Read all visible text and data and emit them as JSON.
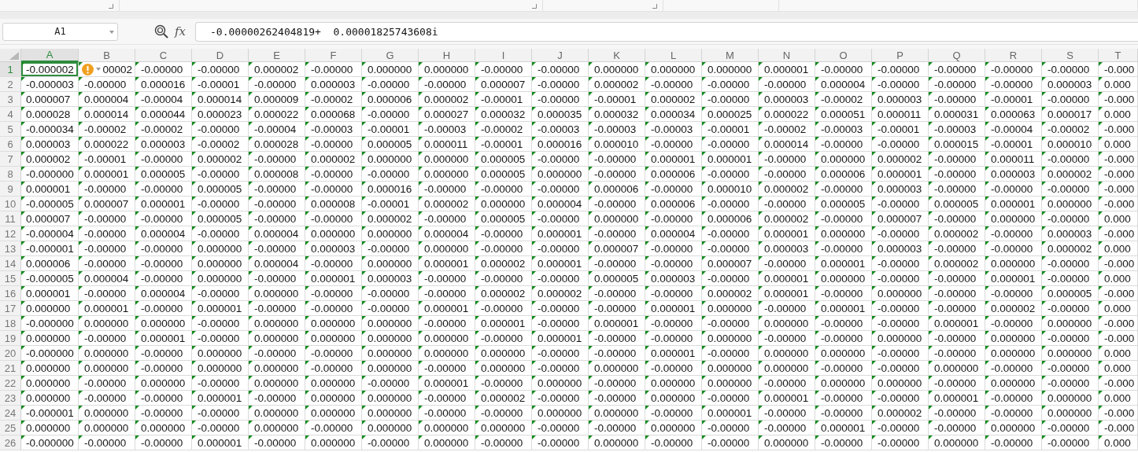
{
  "ribbon": {
    "groups": [
      {
        "launcher": true
      },
      {
        "launcher": true
      },
      {
        "launcher": true
      },
      {
        "launcher": false
      },
      {
        "launcher": false
      }
    ]
  },
  "formula_bar": {
    "name_box": "A1",
    "function_label": "fx",
    "formula": "-0.00000262404819+  0.00001825743608i"
  },
  "error_check": {
    "visible": true
  },
  "columns": [
    {
      "label": "A",
      "selected": true
    },
    {
      "label": "B",
      "selected": false
    },
    {
      "label": "C",
      "selected": false
    },
    {
      "label": "D",
      "selected": false
    },
    {
      "label": "E",
      "selected": false
    },
    {
      "label": "F",
      "selected": false
    },
    {
      "label": "G",
      "selected": false
    },
    {
      "label": "H",
      "selected": false
    },
    {
      "label": "I",
      "selected": false
    },
    {
      "label": "J",
      "selected": false
    },
    {
      "label": "K",
      "selected": false
    },
    {
      "label": "L",
      "selected": false
    },
    {
      "label": "M",
      "selected": false
    },
    {
      "label": "N",
      "selected": false
    },
    {
      "label": "O",
      "selected": false
    },
    {
      "label": "P",
      "selected": false
    },
    {
      "label": "Q",
      "selected": false
    },
    {
      "label": "R",
      "selected": false
    },
    {
      "label": "S",
      "selected": false
    },
    {
      "label": "T",
      "selected": false
    }
  ],
  "rows": [
    {
      "number": "1",
      "selected": true,
      "cells": [
        "-0.000002",
        "00002",
        "-0.00000",
        "-0.00000",
        "0.000002",
        "-0.00000",
        "0.000000",
        "0.000000",
        "-0.00000",
        "-0.00000",
        "0.000000",
        "0.000000",
        "0.000000",
        "0.000001",
        "-0.00000",
        "-0.00000",
        "-0.00000",
        "-0.00000",
        "-0.00000",
        "-0.000"
      ]
    },
    {
      "number": "2",
      "selected": false,
      "cells": [
        "-0.000003",
        "-0.00000",
        "0.000016",
        "-0.00001",
        "-0.00000",
        "0.000003",
        "-0.00000",
        "-0.00000",
        "0.000007",
        "-0.00000",
        "0.000002",
        "-0.00000",
        "-0.00000",
        "-0.00000",
        "0.000004",
        "-0.00000",
        "-0.00000",
        "-0.00000",
        "0.000003",
        "0.000"
      ]
    },
    {
      "number": "3",
      "selected": false,
      "cells": [
        "0.000007",
        "0.000004",
        "-0.00004",
        "0.000014",
        "0.000009",
        "-0.00002",
        "0.000006",
        "0.000002",
        "-0.00001",
        "-0.00000",
        "-0.00001",
        "0.000002",
        "-0.00000",
        "0.000003",
        "-0.00002",
        "0.000003",
        "-0.00000",
        "-0.00001",
        "-0.00000",
        "-0.000"
      ]
    },
    {
      "number": "4",
      "selected": false,
      "cells": [
        "0.000028",
        "0.000014",
        "0.000044",
        "0.000023",
        "0.000022",
        "0.000068",
        "-0.00000",
        "0.000027",
        "0.000032",
        "0.000035",
        "0.000032",
        "0.000034",
        "0.000025",
        "0.000022",
        "0.000051",
        "0.000011",
        "0.000031",
        "0.000063",
        "0.000017",
        "0.000"
      ]
    },
    {
      "number": "5",
      "selected": false,
      "cells": [
        "-0.000034",
        "-0.00002",
        "-0.00002",
        "-0.00000",
        "-0.00004",
        "-0.00003",
        "-0.00001",
        "-0.00003",
        "-0.00002",
        "-0.00003",
        "-0.00003",
        "-0.00003",
        "-0.00001",
        "-0.00002",
        "-0.00003",
        "-0.00001",
        "-0.00003",
        "-0.00004",
        "-0.00002",
        "-0.000"
      ]
    },
    {
      "number": "6",
      "selected": false,
      "cells": [
        "0.000003",
        "0.000022",
        "0.000003",
        "-0.00002",
        "0.000028",
        "-0.00000",
        "0.000005",
        "0.000011",
        "-0.00001",
        "0.000016",
        "0.000010",
        "-0.00000",
        "-0.00000",
        "0.000014",
        "-0.00000",
        "-0.00000",
        "0.000015",
        "-0.00001",
        "0.000010",
        "0.000"
      ]
    },
    {
      "number": "7",
      "selected": false,
      "cells": [
        "0.000002",
        "-0.00001",
        "-0.00000",
        "0.000002",
        "-0.00000",
        "0.000002",
        "0.000000",
        "0.000000",
        "0.000005",
        "-0.00000",
        "-0.00000",
        "0.000001",
        "0.000001",
        "-0.00000",
        "0.000000",
        "0.000002",
        "-0.00000",
        "0.000011",
        "-0.00000",
        "-0.000"
      ]
    },
    {
      "number": "8",
      "selected": false,
      "cells": [
        "-0.000000",
        "0.000001",
        "0.000005",
        "-0.00000",
        "0.000008",
        "-0.00000",
        "-0.00000",
        "0.000000",
        "0.000005",
        "0.000000",
        "-0.00000",
        "0.000006",
        "-0.00000",
        "-0.00000",
        "0.000006",
        "0.000001",
        "-0.00000",
        "0.000003",
        "0.000002",
        "-0.000"
      ]
    },
    {
      "number": "9",
      "selected": false,
      "cells": [
        "0.000001",
        "-0.00000",
        "-0.00000",
        "0.000005",
        "-0.00000",
        "-0.00000",
        "0.000016",
        "-0.00000",
        "-0.00000",
        "-0.00000",
        "0.000006",
        "-0.00000",
        "0.000010",
        "0.000002",
        "-0.00000",
        "0.000003",
        "-0.00000",
        "-0.00000",
        "-0.00000",
        "-0.000"
      ]
    },
    {
      "number": "10",
      "selected": false,
      "cells": [
        "-0.000005",
        "0.000007",
        "0.000001",
        "-0.00000",
        "-0.00000",
        "0.000008",
        "-0.00001",
        "0.000002",
        "0.000000",
        "0.000004",
        "-0.00000",
        "0.000006",
        "-0.00000",
        "-0.00000",
        "0.000005",
        "-0.00000",
        "0.000005",
        "0.000001",
        "0.000000",
        "-0.000"
      ]
    },
    {
      "number": "11",
      "selected": false,
      "cells": [
        "0.000007",
        "-0.00000",
        "-0.00000",
        "0.000005",
        "-0.00000",
        "-0.00000",
        "0.000002",
        "-0.00000",
        "0.000005",
        "-0.00000",
        "0.000000",
        "-0.00000",
        "0.000006",
        "0.000002",
        "-0.00000",
        "0.000007",
        "-0.00000",
        "0.000000",
        "-0.00000",
        "0.000"
      ]
    },
    {
      "number": "12",
      "selected": false,
      "cells": [
        "-0.000004",
        "-0.00000",
        "0.000004",
        "-0.00000",
        "0.000004",
        "0.000000",
        "0.000000",
        "0.000004",
        "-0.00000",
        "0.000001",
        "-0.00000",
        "0.000004",
        "-0.00000",
        "0.000001",
        "0.000000",
        "-0.00000",
        "0.000002",
        "-0.00000",
        "0.000003",
        "-0.000"
      ]
    },
    {
      "number": "13",
      "selected": false,
      "cells": [
        "-0.000001",
        "-0.00000",
        "-0.00000",
        "0.000000",
        "-0.00000",
        "0.000003",
        "-0.00000",
        "0.000000",
        "-0.00000",
        "-0.00000",
        "0.000007",
        "-0.00000",
        "-0.00000",
        "0.000003",
        "-0.00000",
        "0.000003",
        "-0.00000",
        "-0.00000",
        "0.000002",
        "0.000"
      ]
    },
    {
      "number": "14",
      "selected": false,
      "cells": [
        "0.000006",
        "-0.00000",
        "-0.00000",
        "0.000000",
        "0.000004",
        "-0.00000",
        "0.000000",
        "0.000001",
        "0.000002",
        "0.000001",
        "-0.00000",
        "-0.00000",
        "0.000007",
        "-0.00000",
        "0.000001",
        "-0.00000",
        "0.000002",
        "0.000000",
        "-0.00000",
        "-0.000"
      ]
    },
    {
      "number": "15",
      "selected": false,
      "cells": [
        "-0.000005",
        "0.000004",
        "-0.00000",
        "0.000000",
        "-0.00000",
        "0.000001",
        "0.000003",
        "-0.00000",
        "-0.00000",
        "-0.00000",
        "0.000005",
        "0.000003",
        "-0.00000",
        "0.000001",
        "0.000000",
        "-0.00000",
        "-0.00000",
        "0.000001",
        "-0.00000",
        "0.000"
      ]
    },
    {
      "number": "16",
      "selected": false,
      "cells": [
        "0.000001",
        "-0.00000",
        "0.000004",
        "-0.00000",
        "0.000000",
        "-0.00000",
        "-0.00000",
        "-0.00000",
        "0.000002",
        "0.000002",
        "-0.00000",
        "-0.00000",
        "0.000002",
        "0.000001",
        "-0.00000",
        "0.000000",
        "-0.00000",
        "-0.00000",
        "0.000005",
        "-0.000"
      ]
    },
    {
      "number": "17",
      "selected": false,
      "cells": [
        "0.000000",
        "0.000001",
        "-0.00000",
        "0.000001",
        "-0.00000",
        "-0.00000",
        "-0.00000",
        "0.000001",
        "-0.00000",
        "-0.00000",
        "-0.00000",
        "0.000001",
        "0.000000",
        "-0.00000",
        "0.000001",
        "-0.00000",
        "-0.00000",
        "0.000002",
        "-0.00000",
        "0.000"
      ]
    },
    {
      "number": "18",
      "selected": false,
      "cells": [
        "-0.000000",
        "0.000000",
        "0.000000",
        "-0.00000",
        "0.000000",
        "0.000000",
        "0.000000",
        "-0.00000",
        "0.000001",
        "-0.00000",
        "0.000001",
        "-0.00000",
        "-0.00000",
        "0.000000",
        "-0.00000",
        "-0.00000",
        "0.000001",
        "-0.00000",
        "0.000000",
        "-0.000"
      ]
    },
    {
      "number": "19",
      "selected": false,
      "cells": [
        "0.000000",
        "-0.00000",
        "0.000001",
        "-0.00000",
        "0.000000",
        "0.000000",
        "0.000000",
        "0.000000",
        "-0.00000",
        "0.000001",
        "-0.00000",
        "-0.00000",
        "0.000000",
        "-0.00000",
        "-0.00000",
        "0.000000",
        "-0.00000",
        "0.000000",
        "-0.00000",
        "-0.000"
      ]
    },
    {
      "number": "20",
      "selected": false,
      "cells": [
        "-0.000000",
        "0.000000",
        "-0.00000",
        "0.000000",
        "-0.00000",
        "-0.00000",
        "0.000000",
        "0.000000",
        "0.000000",
        "-0.00000",
        "-0.00000",
        "0.000001",
        "-0.00000",
        "0.000000",
        "0.000000",
        "-0.00000",
        "-0.00000",
        "0.000000",
        "0.000000",
        "0.000"
      ]
    },
    {
      "number": "21",
      "selected": false,
      "cells": [
        "0.000000",
        "0.000000",
        "-0.00000",
        "0.000000",
        "0.000000",
        "-0.00000",
        "0.000000",
        "-0.00000",
        "0.000000",
        "-0.00000",
        "0.000000",
        "-0.00000",
        "0.000000",
        "0.000000",
        "-0.00000",
        "-0.00000",
        "0.000000",
        "-0.00000",
        "-0.00000",
        "0.000"
      ]
    },
    {
      "number": "22",
      "selected": false,
      "cells": [
        "0.000000",
        "-0.00000",
        "0.000000",
        "-0.00000",
        "0.000000",
        "0.000000",
        "-0.00000",
        "0.000001",
        "-0.00000",
        "0.000000",
        "-0.00000",
        "0.000000",
        "0.000000",
        "-0.00000",
        "0.000000",
        "0.000000",
        "-0.00000",
        "0.000000",
        "-0.00000",
        "-0.000"
      ]
    },
    {
      "number": "23",
      "selected": false,
      "cells": [
        "0.000000",
        "-0.00000",
        "-0.00000",
        "0.000001",
        "-0.00000",
        "0.000000",
        "0.000000",
        "-0.00000",
        "0.000002",
        "-0.00000",
        "-0.00000",
        "0.000000",
        "-0.00000",
        "0.000001",
        "-0.00000",
        "-0.00000",
        "0.000001",
        "-0.00000",
        "0.000000",
        "0.000"
      ]
    },
    {
      "number": "24",
      "selected": false,
      "cells": [
        "-0.000001",
        "0.000000",
        "-0.00000",
        "-0.00000",
        "0.000000",
        "0.000000",
        "0.000000",
        "-0.00000",
        "-0.00000",
        "0.000000",
        "0.000000",
        "-0.00000",
        "0.000001",
        "-0.00000",
        "-0.00000",
        "0.000002",
        "-0.00000",
        "-0.00000",
        "0.000000",
        "-0.000"
      ]
    },
    {
      "number": "25",
      "selected": false,
      "cells": [
        "0.000000",
        "0.000000",
        "0.000000",
        "-0.00000",
        "0.000000",
        "-0.00000",
        "0.000000",
        "0.000000",
        "0.000000",
        "-0.00000",
        "-0.00000",
        "0.000000",
        "-0.00000",
        "-0.00000",
        "0.000001",
        "-0.00000",
        "-0.00000",
        "0.000000",
        "-0.00000",
        "-0.000"
      ]
    },
    {
      "number": "26",
      "selected": false,
      "cells": [
        "-0.000000",
        "-0.00000",
        "-0.00000",
        "0.000001",
        "-0.00000",
        "0.000000",
        "-0.00000",
        "0.000000",
        "-0.00000",
        "-0.00000",
        "0.000000",
        "-0.00000",
        "-0.00000",
        "0.000000",
        "-0.00000",
        "-0.00000",
        "0.000000",
        "-0.00000",
        "-0.00000",
        "0.000"
      ]
    }
  ]
}
